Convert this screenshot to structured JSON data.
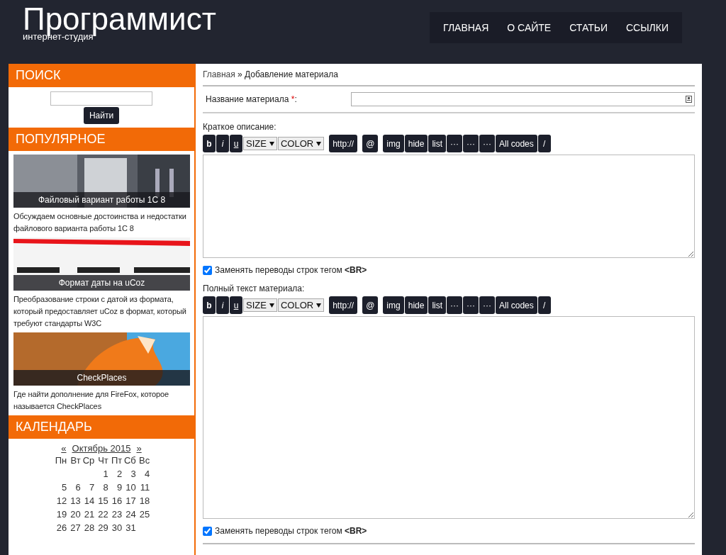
{
  "site": {
    "title": "Программист",
    "subtitle": "интернет-студия"
  },
  "nav": [
    {
      "label": "ГЛАВНАЯ"
    },
    {
      "label": "О САЙТЕ"
    },
    {
      "label": "СТАТЬИ"
    },
    {
      "label": "ССЫЛКИ"
    }
  ],
  "sidebar": {
    "search": {
      "title": "ПОИСК",
      "button": "Найти"
    },
    "popular": {
      "title": "ПОПУЛЯРНОЕ",
      "items": [
        {
          "kind": "picture",
          "caption": "Файловый вариант работы 1С 8",
          "description": "Обсуждаем основные достоинства и недостатки файлового варианта работы 1С 8"
        },
        {
          "kind": "picture",
          "caption": "Формат даты на uCoz",
          "description": "Преобразование строки с датой из формата, который предоставляет uCoz в формат, который требуют стандарты W3C"
        },
        {
          "kind": "picture",
          "caption": "CheckPlaces",
          "description": "Где найти дополнение для FireFox, которое называется CheckPlaces"
        }
      ]
    },
    "calendar": {
      "title": "КАЛЕНДАРЬ",
      "prev": "«",
      "month": "Октябрь 2015",
      "next": "»",
      "weekdays": [
        "Пн",
        "Вт",
        "Ср",
        "Чт",
        "Пт",
        "Сб",
        "Вс"
      ],
      "weeks": [
        [
          "1",
          "2",
          "3",
          "4"
        ],
        [
          "5",
          "6",
          "7",
          "8",
          "9",
          "10",
          "11"
        ],
        [
          "12",
          "13",
          "14",
          "15",
          "16",
          "17",
          "18"
        ],
        [
          "19",
          "20",
          "21",
          "22",
          "23",
          "24",
          "25"
        ],
        [
          "26",
          "27",
          "28",
          "29",
          "30",
          "31"
        ]
      ]
    }
  },
  "breadcrumb": {
    "home": "Главная",
    "separator": "»",
    "current": "Добавление материала"
  },
  "form": {
    "title_label": "Название материала",
    "required_mark": "*",
    "title_colon": ":",
    "editors": [
      {
        "label": "Краткое описание:",
        "toolbar": [
          [
            {
              "kind": "button",
              "label": "b"
            },
            {
              "kind": "button",
              "label": "i"
            },
            {
              "kind": "button",
              "label": "u"
            },
            {
              "kind": "select",
              "label": "SIZE"
            },
            {
              "kind": "select",
              "label": "COLOR"
            }
          ],
          [
            {
              "kind": "button",
              "label": "http://"
            }
          ],
          [
            {
              "kind": "button",
              "label": "@"
            }
          ],
          [
            {
              "kind": "button",
              "label": "img"
            },
            {
              "kind": "button",
              "label": "hide"
            },
            {
              "kind": "button",
              "label": "list"
            },
            {
              "kind": "button",
              "label": "···"
            },
            {
              "kind": "button",
              "label": "···"
            },
            {
              "kind": "button",
              "label": "···"
            },
            {
              "kind": "button",
              "label": "All codes"
            },
            {
              "kind": "button",
              "label": "/"
            }
          ]
        ],
        "checkbox": {
          "label": "Заменять переводы строк тегом **<BR>**",
          "checked": true
        }
      },
      {
        "label": "Полный текст материала:",
        "toolbar": [
          [
            {
              "kind": "button",
              "label": "b"
            },
            {
              "kind": "button",
              "label": "i"
            },
            {
              "kind": "button",
              "label": "u"
            },
            {
              "kind": "select",
              "label": "SIZE"
            },
            {
              "kind": "select",
              "label": "COLOR"
            }
          ],
          [
            {
              "kind": "button",
              "label": "http://"
            }
          ],
          [
            {
              "kind": "button",
              "label": "@"
            }
          ],
          [
            {
              "kind": "button",
              "label": "img"
            },
            {
              "kind": "button",
              "label": "hide"
            },
            {
              "kind": "button",
              "label": "list"
            },
            {
              "kind": "button",
              "label": "···"
            },
            {
              "kind": "button",
              "label": "···"
            },
            {
              "kind": "button",
              "label": "···"
            },
            {
              "kind": "button",
              "label": "All codes"
            },
            {
              "kind": "button",
              "label": "/"
            }
          ]
        ],
        "checkbox": {
          "label": "Заменять переводы строк тегом **<BR>**",
          "checked": true
        }
      }
    ]
  }
}
